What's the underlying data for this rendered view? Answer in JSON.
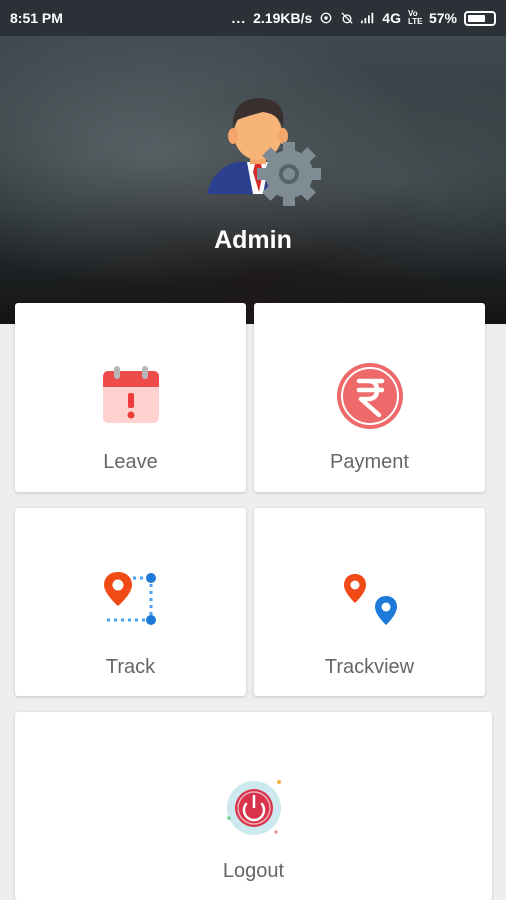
{
  "status_bar": {
    "time": "8:51 PM",
    "dots": "...",
    "network_speed": "2.19KB/s",
    "network_type": "4G",
    "volte": "Vo LTE",
    "battery": "57%"
  },
  "header": {
    "user_name": "Admin",
    "avatar_icon": "admin-settings-icon"
  },
  "menu": [
    {
      "label": "Leave",
      "icon": "calendar-alert-icon"
    },
    {
      "label": "Payment",
      "icon": "rupee-icon"
    },
    {
      "label": "Track",
      "icon": "route-track-icon"
    },
    {
      "label": "Trackview",
      "icon": "map-pins-icon"
    },
    {
      "label": "Logout",
      "icon": "power-icon"
    }
  ],
  "colors": {
    "status_bar": "#2b3137",
    "calendar_red": "#ee4b4b",
    "rupee_red": "#ee6a6a",
    "pin_orange": "#f04a16",
    "pin_blue": "#1e7ad8",
    "power_red": "#d8334a"
  }
}
